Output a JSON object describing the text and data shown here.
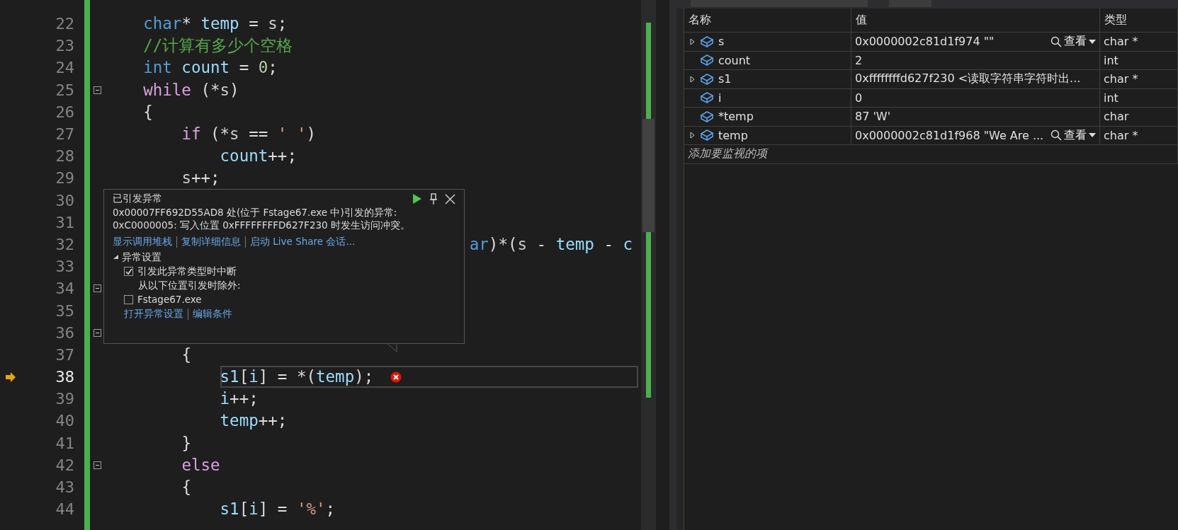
{
  "editor": {
    "lines": [
      {
        "number": "22",
        "fold": false,
        "current": false,
        "segments": [
          {
            "kind": "keyword",
            "text": "    char"
          },
          {
            "kind": "plain",
            "text": "* "
          },
          {
            "kind": "local",
            "text": "temp"
          },
          {
            "kind": "plain",
            "text": " = "
          },
          {
            "kind": "param",
            "text": "s"
          },
          {
            "kind": "plain",
            "text": ";"
          }
        ]
      },
      {
        "number": "23",
        "fold": false,
        "current": false,
        "segments": [
          {
            "kind": "comment",
            "text": "    //计算有多少个空格"
          }
        ]
      },
      {
        "number": "24",
        "fold": false,
        "current": false,
        "segments": [
          {
            "kind": "keyword",
            "text": "    int"
          },
          {
            "kind": "local",
            "text": " count"
          },
          {
            "kind": "plain",
            "text": " = "
          },
          {
            "kind": "number",
            "text": "0"
          },
          {
            "kind": "plain",
            "text": ";"
          }
        ]
      },
      {
        "number": "25",
        "fold": true,
        "current": false,
        "segments": [
          {
            "kind": "control",
            "text": "    while"
          },
          {
            "kind": "plain",
            "text": " (*"
          },
          {
            "kind": "param",
            "text": "s"
          },
          {
            "kind": "plain",
            "text": ")"
          }
        ]
      },
      {
        "number": "26",
        "fold": false,
        "current": false,
        "segments": [
          {
            "kind": "plain",
            "text": "    {"
          }
        ]
      },
      {
        "number": "27",
        "fold": false,
        "current": false,
        "segments": [
          {
            "kind": "control",
            "text": "        if"
          },
          {
            "kind": "plain",
            "text": " (*"
          },
          {
            "kind": "param",
            "text": "s"
          },
          {
            "kind": "plain",
            "text": " == "
          },
          {
            "kind": "string",
            "text": "' '"
          },
          {
            "kind": "plain",
            "text": ")"
          }
        ]
      },
      {
        "number": "28",
        "fold": false,
        "current": false,
        "segments": [
          {
            "kind": "local",
            "text": "            count"
          },
          {
            "kind": "plain",
            "text": "++;"
          }
        ]
      },
      {
        "number": "29",
        "fold": false,
        "current": false,
        "segments": [
          {
            "kind": "param",
            "text": "        s"
          },
          {
            "kind": "plain",
            "text": "++;"
          }
        ]
      },
      {
        "number": "30",
        "fold": false,
        "current": false
      },
      {
        "number": "31",
        "fold": false,
        "current": false
      },
      {
        "number": "32",
        "fold": false,
        "current": false,
        "segments": [
          {
            "kind": "keyword",
            "text": "                                      ar"
          },
          {
            "kind": "plain",
            "text": ")*("
          },
          {
            "kind": "param",
            "text": "s"
          },
          {
            "kind": "plain",
            "text": " - "
          },
          {
            "kind": "local",
            "text": "temp"
          },
          {
            "kind": "plain",
            "text": " - "
          },
          {
            "kind": "local",
            "text": "c"
          }
        ]
      },
      {
        "number": "33",
        "fold": false,
        "current": false
      },
      {
        "number": "34",
        "fold": true,
        "current": false
      },
      {
        "number": "35",
        "fold": false,
        "current": false
      },
      {
        "number": "36",
        "fold": true,
        "current": false
      },
      {
        "number": "37",
        "fold": false,
        "current": false,
        "segments": [
          {
            "kind": "plain",
            "text": "        {"
          }
        ]
      },
      {
        "number": "38",
        "fold": false,
        "current": true,
        "segments": [
          {
            "kind": "local",
            "text": "            s1"
          },
          {
            "kind": "plain",
            "text": "["
          },
          {
            "kind": "local",
            "text": "i"
          },
          {
            "kind": "plain",
            "text": "] = *("
          },
          {
            "kind": "local",
            "text": "temp"
          },
          {
            "kind": "plain",
            "text": ");"
          }
        ]
      },
      {
        "number": "39",
        "fold": false,
        "current": false,
        "segments": [
          {
            "kind": "local",
            "text": "            i"
          },
          {
            "kind": "plain",
            "text": "++;"
          }
        ]
      },
      {
        "number": "40",
        "fold": false,
        "current": false,
        "segments": [
          {
            "kind": "local",
            "text": "            temp"
          },
          {
            "kind": "plain",
            "text": "++;"
          }
        ]
      },
      {
        "number": "41",
        "fold": false,
        "current": false,
        "segments": [
          {
            "kind": "plain",
            "text": "        }"
          }
        ]
      },
      {
        "number": "42",
        "fold": true,
        "current": false,
        "segments": [
          {
            "kind": "control",
            "text": "        else"
          }
        ]
      },
      {
        "number": "43",
        "fold": false,
        "current": false,
        "segments": [
          {
            "kind": "plain",
            "text": "        {"
          }
        ]
      },
      {
        "number": "44",
        "fold": false,
        "current": false,
        "segments": [
          {
            "kind": "local",
            "text": "            s1"
          },
          {
            "kind": "plain",
            "text": "["
          },
          {
            "kind": "local",
            "text": "i"
          },
          {
            "kind": "plain",
            "text": "] = "
          },
          {
            "kind": "string",
            "text": "'%'"
          },
          {
            "kind": "plain",
            "text": ";"
          }
        ]
      }
    ]
  },
  "exception_popup": {
    "title": "已引发异常",
    "message": [
      "0x00007FF692D55AD8 处(位于 Fstage67.exe 中)引发的异常:",
      "0xC0000005: 写入位置 0xFFFFFFFFD627F230 时发生访问冲突。"
    ],
    "links": [
      "显示调用堆栈",
      "复制详细信息",
      "启动 Live Share 会话..."
    ],
    "settings": {
      "label": "异常设置",
      "expanded": true,
      "items": [
        {
          "kind": "checkbox",
          "label": "引发此异常类型时中断",
          "checked": true
        },
        {
          "kind": "text",
          "label": "从以下位置引发时除外:"
        },
        {
          "kind": "checkbox",
          "label": "Fstage67.exe",
          "checked": false
        }
      ]
    },
    "footer_links": [
      "打开异常设置",
      "编辑条件"
    ]
  },
  "watch": {
    "columns": [
      "名称",
      "值",
      "类型"
    ],
    "rows": [
      {
        "name": "s",
        "value": "0x0000002c81d1f974 \"\"",
        "type": "char *",
        "expandable": true,
        "view": "查看"
      },
      {
        "name": "count",
        "value": "2",
        "type": "int",
        "expandable": false
      },
      {
        "name": "s1",
        "value": "0xffffffffd627f230 <读取字符串字符时出...",
        "type": "char *",
        "expandable": true
      },
      {
        "name": "i",
        "value": "0",
        "type": "int",
        "expandable": false
      },
      {
        "name": "*temp",
        "value": "87 'W'",
        "type": "char",
        "expandable": false
      },
      {
        "name": "temp",
        "value": "0x0000002c81d1f968 \"We Are ...",
        "type": "char *",
        "expandable": true,
        "view": "查看"
      }
    ],
    "placeholder": "添加要监视的项"
  }
}
